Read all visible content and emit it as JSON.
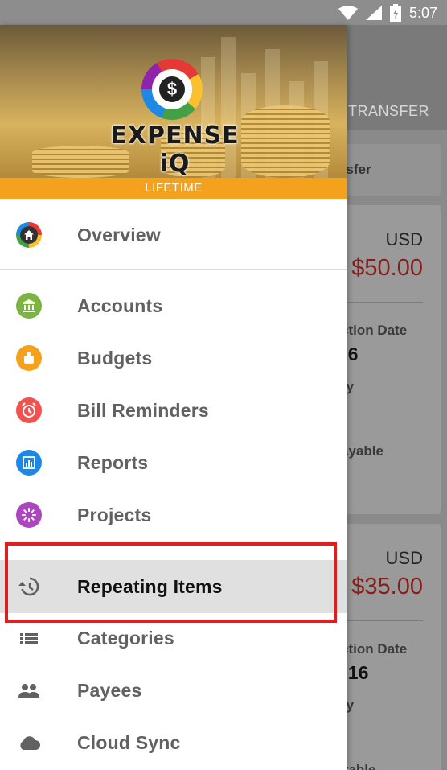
{
  "status_bar": {
    "time": "5:07"
  },
  "background": {
    "tab": "TRANSFER",
    "filter_fragment": "nsfer",
    "cards": [
      {
        "currency": "USD",
        "amount": "$50.00",
        "date_label": "ction Date",
        "date_value": "16",
        "row2": "ry",
        "row3": "ayable"
      },
      {
        "currency": "USD",
        "amount": "$35.00",
        "date_label": "ction Date",
        "date_value": "016",
        "row2": "ry",
        "row3": "yable"
      }
    ]
  },
  "drawer": {
    "logo_text": "EXPENSE iQ",
    "logo_symbol": "$",
    "plan_badge": "LIFETIME",
    "items": [
      {
        "label": "Overview",
        "icon": "home-icon",
        "color": "#333333"
      },
      {
        "label": "Accounts",
        "icon": "bank-icon",
        "color": "#7cb342"
      },
      {
        "label": "Budgets",
        "icon": "piggy-bank-icon",
        "color": "#f4a11d"
      },
      {
        "label": "Bill Reminders",
        "icon": "alarm-clock-icon",
        "color": "#e53935"
      },
      {
        "label": "Reports",
        "icon": "report-chart-icon",
        "color": "#1e88e5"
      },
      {
        "label": "Projects",
        "icon": "spinner-icon",
        "color": "#ab47bc"
      },
      {
        "label": "Repeating Items",
        "icon": "history-icon",
        "color": "#616161"
      },
      {
        "label": "Categories",
        "icon": "list-icon",
        "color": "#616161"
      },
      {
        "label": "Payees",
        "icon": "people-icon",
        "color": "#616161"
      },
      {
        "label": "Cloud Sync",
        "icon": "cloud-icon",
        "color": "#616161"
      }
    ],
    "active_item": "Repeating Items"
  }
}
